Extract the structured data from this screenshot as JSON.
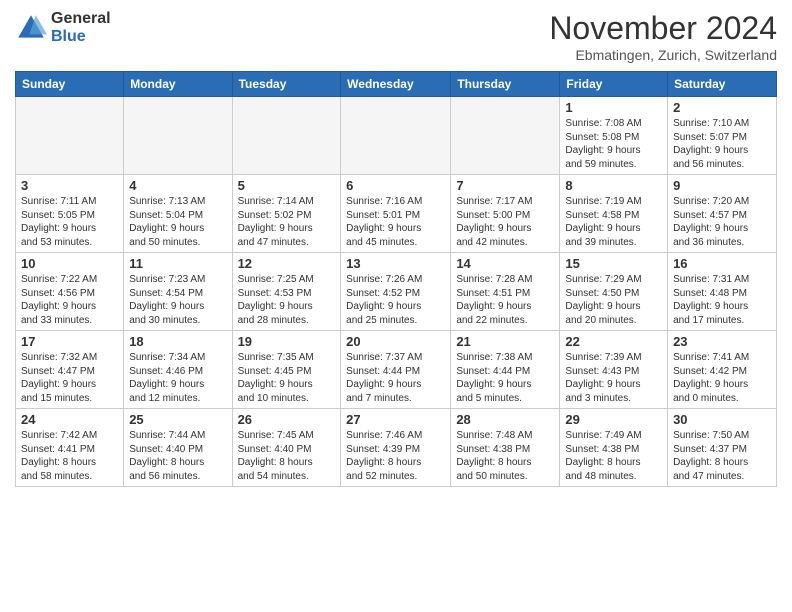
{
  "header": {
    "logo_general": "General",
    "logo_blue": "Blue",
    "month_title": "November 2024",
    "location": "Ebmatingen, Zurich, Switzerland"
  },
  "days_of_week": [
    "Sunday",
    "Monday",
    "Tuesday",
    "Wednesday",
    "Thursday",
    "Friday",
    "Saturday"
  ],
  "weeks": [
    [
      {
        "day": "",
        "info": ""
      },
      {
        "day": "",
        "info": ""
      },
      {
        "day": "",
        "info": ""
      },
      {
        "day": "",
        "info": ""
      },
      {
        "day": "",
        "info": ""
      },
      {
        "day": "1",
        "info": "Sunrise: 7:08 AM\nSunset: 5:08 PM\nDaylight: 9 hours\nand 59 minutes."
      },
      {
        "day": "2",
        "info": "Sunrise: 7:10 AM\nSunset: 5:07 PM\nDaylight: 9 hours\nand 56 minutes."
      }
    ],
    [
      {
        "day": "3",
        "info": "Sunrise: 7:11 AM\nSunset: 5:05 PM\nDaylight: 9 hours\nand 53 minutes."
      },
      {
        "day": "4",
        "info": "Sunrise: 7:13 AM\nSunset: 5:04 PM\nDaylight: 9 hours\nand 50 minutes."
      },
      {
        "day": "5",
        "info": "Sunrise: 7:14 AM\nSunset: 5:02 PM\nDaylight: 9 hours\nand 47 minutes."
      },
      {
        "day": "6",
        "info": "Sunrise: 7:16 AM\nSunset: 5:01 PM\nDaylight: 9 hours\nand 45 minutes."
      },
      {
        "day": "7",
        "info": "Sunrise: 7:17 AM\nSunset: 5:00 PM\nDaylight: 9 hours\nand 42 minutes."
      },
      {
        "day": "8",
        "info": "Sunrise: 7:19 AM\nSunset: 4:58 PM\nDaylight: 9 hours\nand 39 minutes."
      },
      {
        "day": "9",
        "info": "Sunrise: 7:20 AM\nSunset: 4:57 PM\nDaylight: 9 hours\nand 36 minutes."
      }
    ],
    [
      {
        "day": "10",
        "info": "Sunrise: 7:22 AM\nSunset: 4:56 PM\nDaylight: 9 hours\nand 33 minutes."
      },
      {
        "day": "11",
        "info": "Sunrise: 7:23 AM\nSunset: 4:54 PM\nDaylight: 9 hours\nand 30 minutes."
      },
      {
        "day": "12",
        "info": "Sunrise: 7:25 AM\nSunset: 4:53 PM\nDaylight: 9 hours\nand 28 minutes."
      },
      {
        "day": "13",
        "info": "Sunrise: 7:26 AM\nSunset: 4:52 PM\nDaylight: 9 hours\nand 25 minutes."
      },
      {
        "day": "14",
        "info": "Sunrise: 7:28 AM\nSunset: 4:51 PM\nDaylight: 9 hours\nand 22 minutes."
      },
      {
        "day": "15",
        "info": "Sunrise: 7:29 AM\nSunset: 4:50 PM\nDaylight: 9 hours\nand 20 minutes."
      },
      {
        "day": "16",
        "info": "Sunrise: 7:31 AM\nSunset: 4:48 PM\nDaylight: 9 hours\nand 17 minutes."
      }
    ],
    [
      {
        "day": "17",
        "info": "Sunrise: 7:32 AM\nSunset: 4:47 PM\nDaylight: 9 hours\nand 15 minutes."
      },
      {
        "day": "18",
        "info": "Sunrise: 7:34 AM\nSunset: 4:46 PM\nDaylight: 9 hours\nand 12 minutes."
      },
      {
        "day": "19",
        "info": "Sunrise: 7:35 AM\nSunset: 4:45 PM\nDaylight: 9 hours\nand 10 minutes."
      },
      {
        "day": "20",
        "info": "Sunrise: 7:37 AM\nSunset: 4:44 PM\nDaylight: 9 hours\nand 7 minutes."
      },
      {
        "day": "21",
        "info": "Sunrise: 7:38 AM\nSunset: 4:44 PM\nDaylight: 9 hours\nand 5 minutes."
      },
      {
        "day": "22",
        "info": "Sunrise: 7:39 AM\nSunset: 4:43 PM\nDaylight: 9 hours\nand 3 minutes."
      },
      {
        "day": "23",
        "info": "Sunrise: 7:41 AM\nSunset: 4:42 PM\nDaylight: 9 hours\nand 0 minutes."
      }
    ],
    [
      {
        "day": "24",
        "info": "Sunrise: 7:42 AM\nSunset: 4:41 PM\nDaylight: 8 hours\nand 58 minutes."
      },
      {
        "day": "25",
        "info": "Sunrise: 7:44 AM\nSunset: 4:40 PM\nDaylight: 8 hours\nand 56 minutes."
      },
      {
        "day": "26",
        "info": "Sunrise: 7:45 AM\nSunset: 4:40 PM\nDaylight: 8 hours\nand 54 minutes."
      },
      {
        "day": "27",
        "info": "Sunrise: 7:46 AM\nSunset: 4:39 PM\nDaylight: 8 hours\nand 52 minutes."
      },
      {
        "day": "28",
        "info": "Sunrise: 7:48 AM\nSunset: 4:38 PM\nDaylight: 8 hours\nand 50 minutes."
      },
      {
        "day": "29",
        "info": "Sunrise: 7:49 AM\nSunset: 4:38 PM\nDaylight: 8 hours\nand 48 minutes."
      },
      {
        "day": "30",
        "info": "Sunrise: 7:50 AM\nSunset: 4:37 PM\nDaylight: 8 hours\nand 47 minutes."
      }
    ]
  ]
}
